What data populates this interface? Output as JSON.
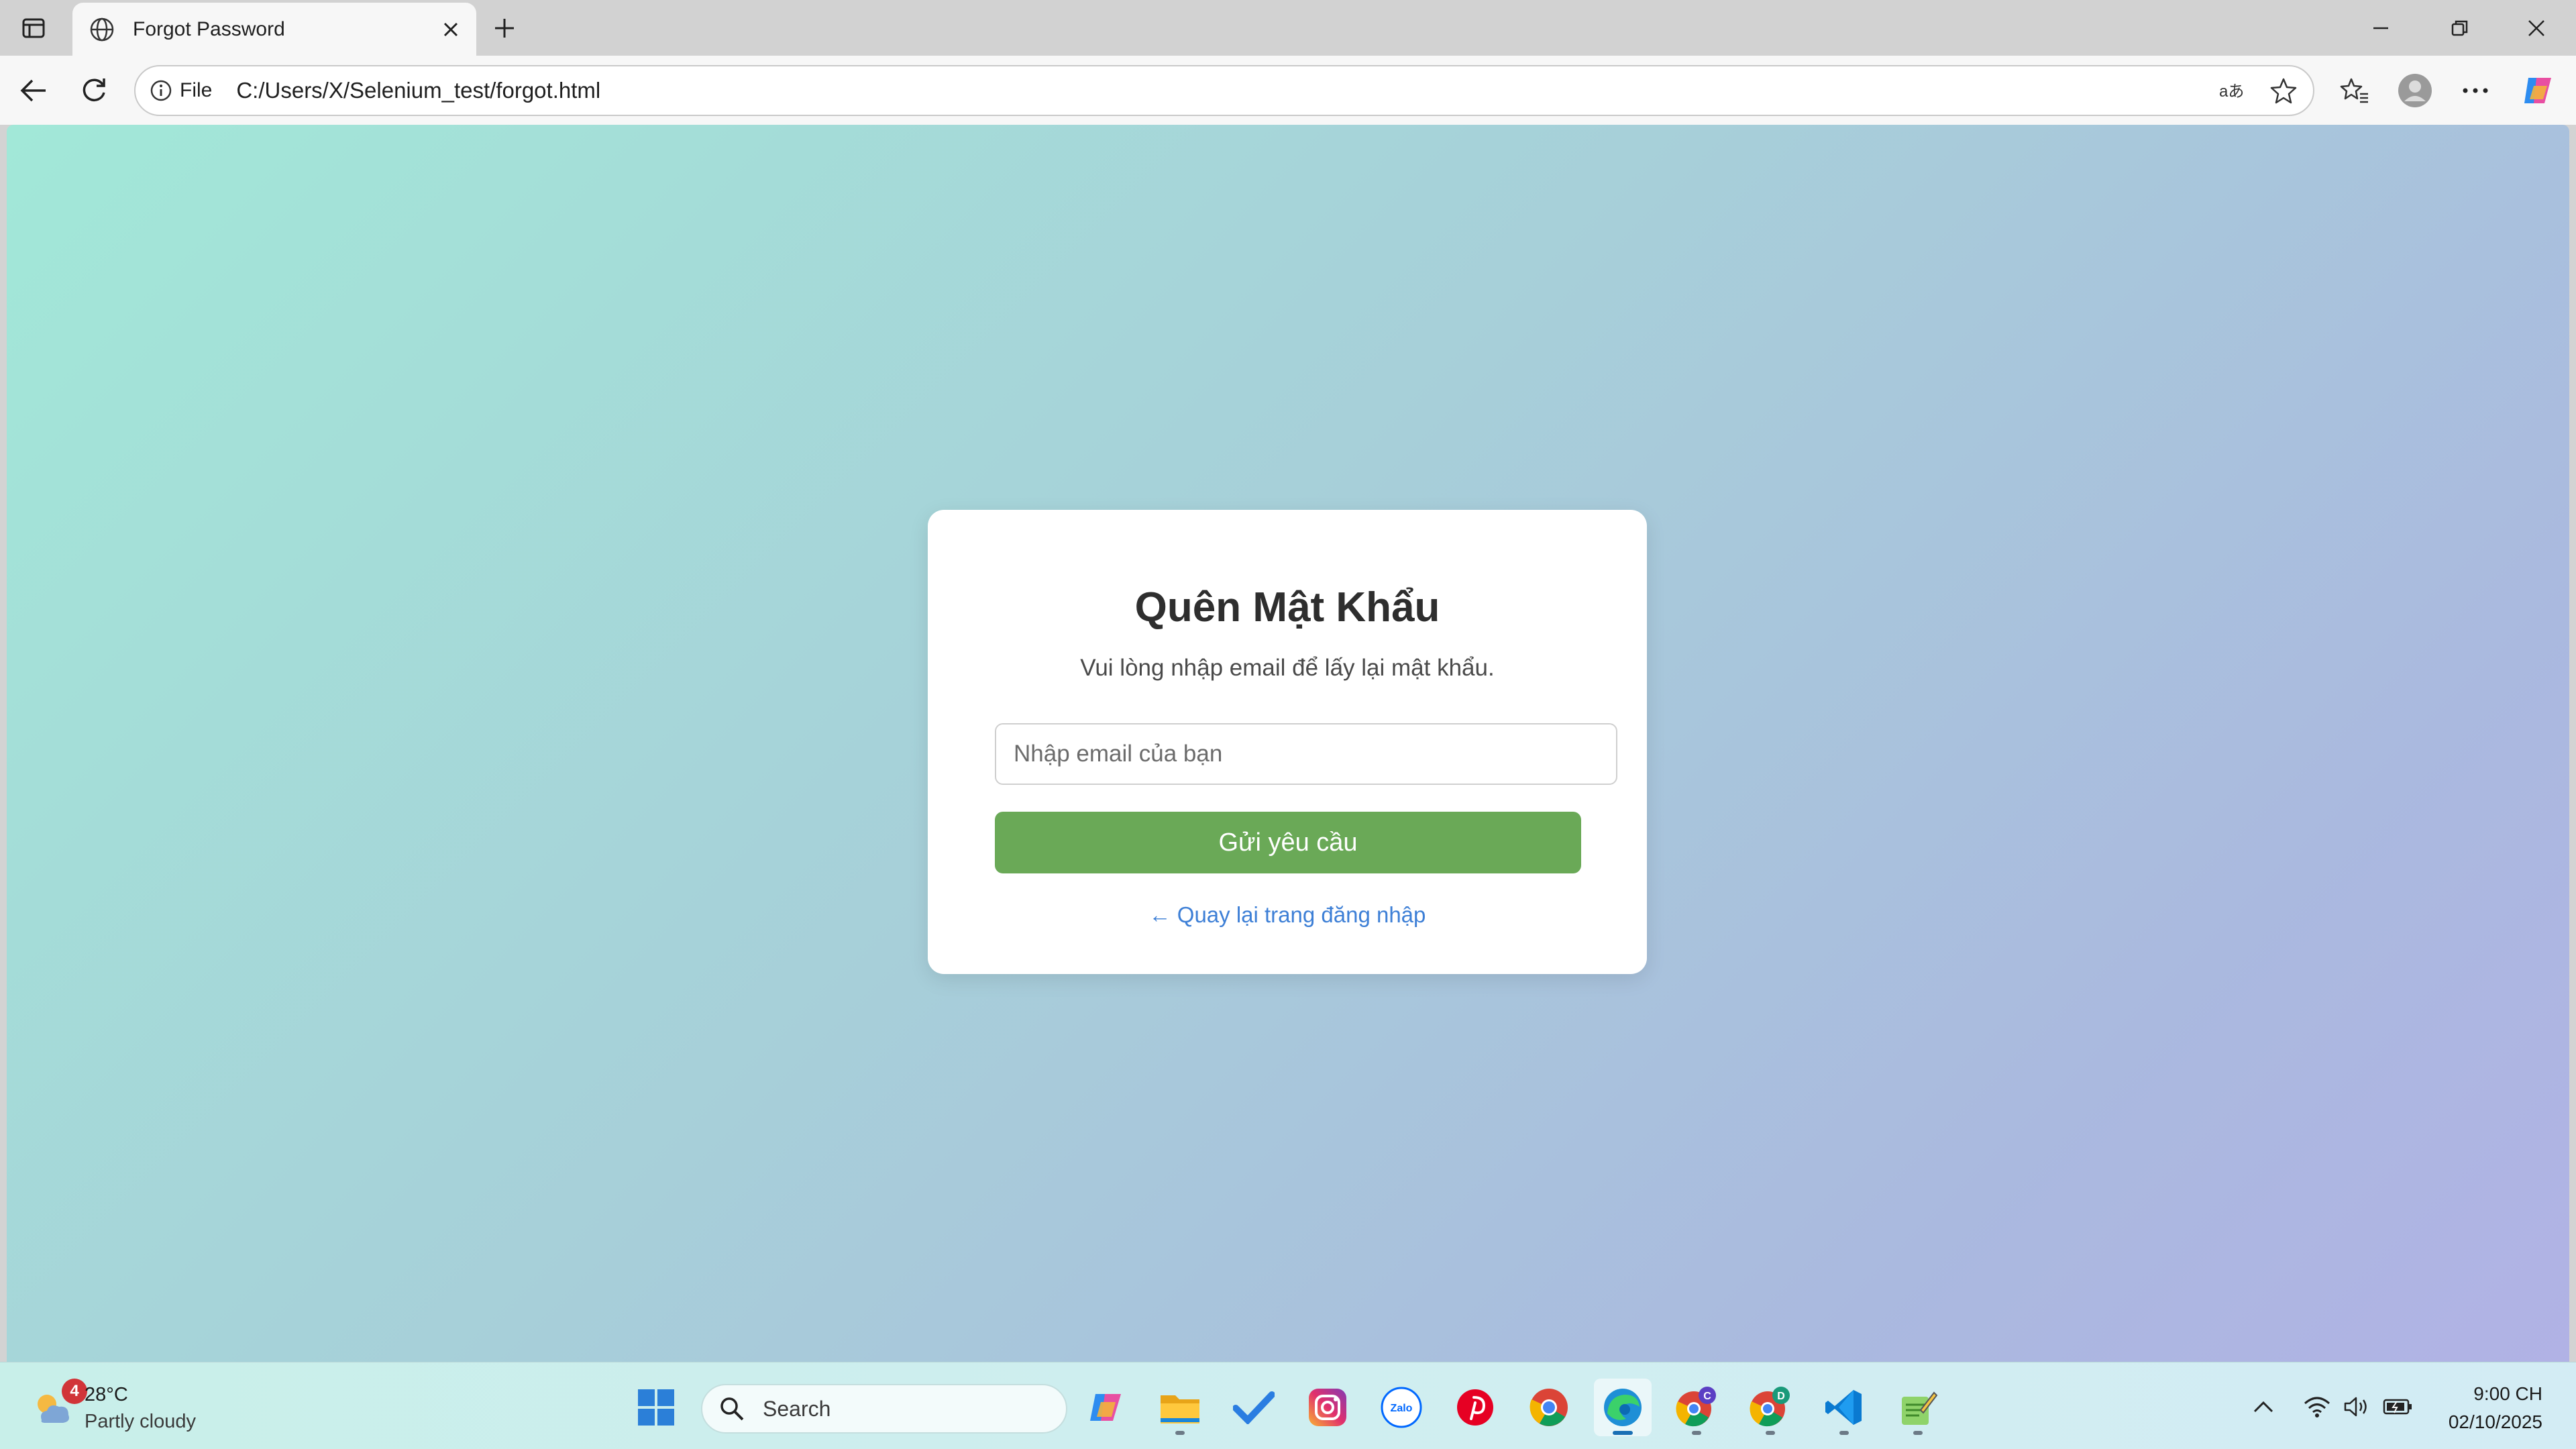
{
  "browser": {
    "tab_title": "Forgot Password",
    "address_scheme": "File",
    "address_url": "C:/Users/X/Selenium_test/forgot.html"
  },
  "page": {
    "title": "Quên Mật Khẩu",
    "subtitle": "Vui lòng nhập email để lấy lại mật khẩu.",
    "email_placeholder": "Nhập email của bạn",
    "email_value": "",
    "submit_label": "Gửi yêu cầu",
    "back_link": "← Quay lại trang đăng nhập",
    "colors": {
      "submit_button": "#6aa957",
      "link": "#3d7fd6",
      "gradient_start": "#a2e8d8",
      "gradient_end": "#b1b2e5"
    }
  },
  "taskbar": {
    "weather_temp": "28°C",
    "weather_desc": "Partly cloudy",
    "weather_badge": "4",
    "search_label": "Search",
    "clock_time": "9:00 CH",
    "clock_date": "02/10/2025",
    "apps": [
      "start-icon",
      "copilot-icon",
      "file-explorer-icon",
      "todo-icon",
      "instagram-icon",
      "zalo-icon",
      "pinterest-icon",
      "chrome-icon",
      "edge-icon",
      "chrome-profile-c-icon",
      "chrome-profile-d-icon",
      "vscode-icon",
      "notepad-icon"
    ],
    "zalo_label": "Zalo",
    "chrome_c_badge": "C",
    "chrome_d_badge": "D"
  }
}
